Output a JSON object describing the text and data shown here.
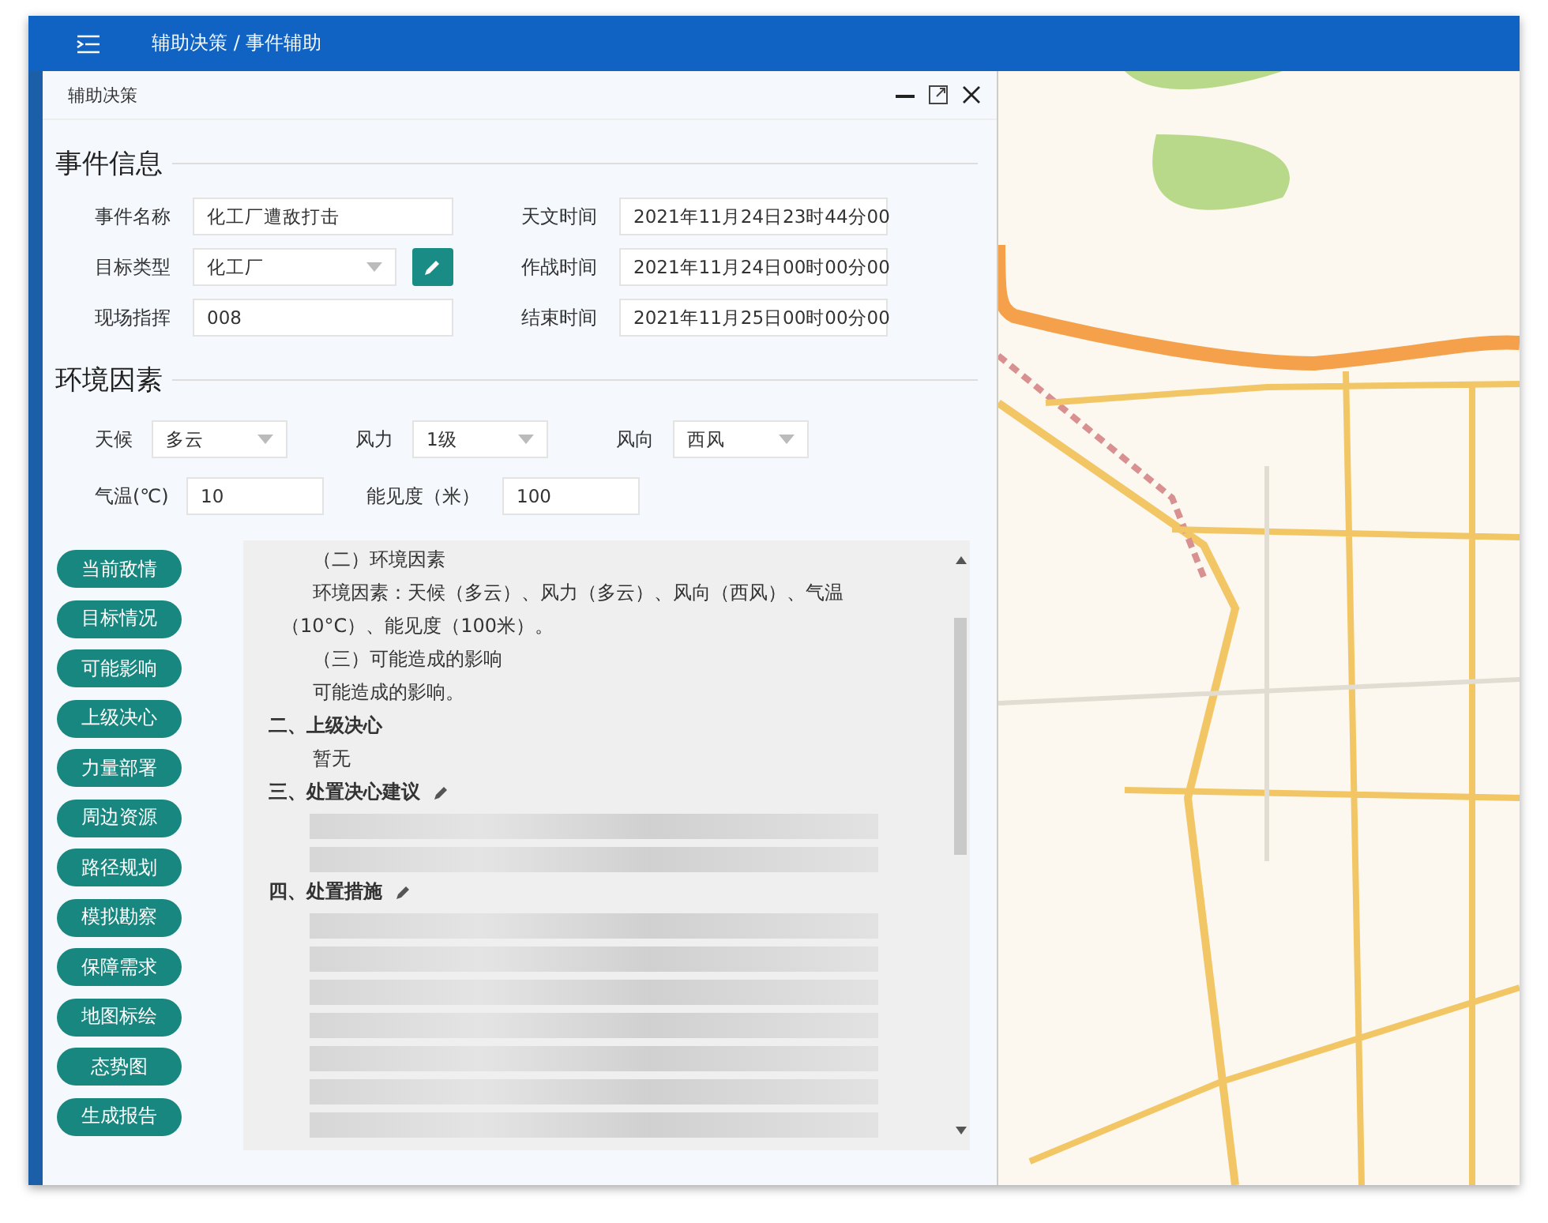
{
  "top_bar": {
    "breadcrumb": "辅助决策 / 事件辅助"
  },
  "panel": {
    "title": "辅助决策"
  },
  "event_info": {
    "heading": "事件信息",
    "fields": [
      {
        "label": "事件名称",
        "value": "化工厂遭敌打击",
        "kind": "text"
      },
      {
        "label": "天文时间",
        "value": "2021年11月24日23时44分00",
        "kind": "text"
      },
      {
        "label": "目标类型",
        "value": "化工厂",
        "kind": "editselect"
      },
      {
        "label": "作战时间",
        "value": "2021年11月24日00时00分00",
        "kind": "text"
      },
      {
        "label": "现场指挥",
        "value": "008",
        "kind": "text"
      },
      {
        "label": "结束时间",
        "value": "2021年11月25日00时00分00",
        "kind": "text"
      }
    ]
  },
  "environment": {
    "heading": "环境因素",
    "fields": [
      {
        "label": "天候",
        "value": "多云",
        "kind": "select"
      },
      {
        "label": "风力",
        "value": "1级",
        "kind": "select"
      },
      {
        "label": "风向",
        "value": "西风",
        "kind": "select"
      },
      {
        "label": "气温(℃)",
        "value": "10",
        "kind": "text"
      },
      {
        "label": "能见度（米）",
        "value": "100",
        "kind": "text"
      }
    ]
  },
  "nav_buttons": [
    "当前敌情",
    "目标情况",
    "可能影响",
    "上级决心",
    "力量部署",
    "周边资源",
    "路径规划",
    "模拟勘察",
    "保障需求",
    "地图标绘",
    "态势图",
    "生成报告"
  ],
  "document": {
    "lines": [
      {
        "kind": "sub",
        "text": "（二）环境因素"
      },
      {
        "kind": "para",
        "text": "环境因素：天候（多云）、风力（多云）、风向（西风）、气温（10°C）、能见度（100米）。"
      },
      {
        "kind": "sub",
        "text": "（三）可能造成的影响"
      },
      {
        "kind": "para",
        "text": "可能造成的影响。"
      },
      {
        "kind": "section",
        "text": "二、上级决心",
        "editable": false
      },
      {
        "kind": "para",
        "text": "暂无"
      },
      {
        "kind": "section",
        "text": "三、处置决心建议",
        "editable": true
      },
      {
        "kind": "redacted"
      },
      {
        "kind": "redacted"
      },
      {
        "kind": "section",
        "text": "四、处置措施",
        "editable": true
      },
      {
        "kind": "redacted"
      },
      {
        "kind": "redacted"
      },
      {
        "kind": "redacted"
      },
      {
        "kind": "redacted"
      },
      {
        "kind": "redacted"
      },
      {
        "kind": "redacted"
      },
      {
        "kind": "redacted"
      }
    ]
  }
}
